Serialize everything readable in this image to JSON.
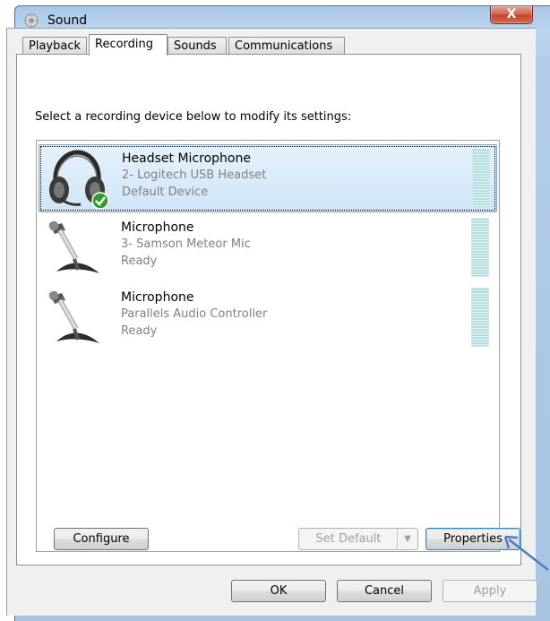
{
  "window": {
    "title": "Sound",
    "close_label": "X"
  },
  "tabs": [
    {
      "label": "Playback"
    },
    {
      "label": "Recording",
      "active": true
    },
    {
      "label": "Sounds"
    },
    {
      "label": "Communications"
    }
  ],
  "instruction": "Select a recording device below to modify its settings:",
  "devices": [
    {
      "name": "Headset Microphone",
      "detail": "2- Logitech USB Headset",
      "status": "Default Device",
      "icon": "headset-icon",
      "selected": true,
      "is_default": true
    },
    {
      "name": "Microphone",
      "detail": "3- Samson Meteor Mic",
      "status": "Ready",
      "icon": "microphone-icon",
      "selected": false
    },
    {
      "name": "Microphone",
      "detail": "Parallels Audio Controller",
      "status": "Ready",
      "icon": "microphone-icon",
      "selected": false
    }
  ],
  "buttons": {
    "configure": "Configure",
    "set_default": "Set Default",
    "properties": "Properties",
    "ok": "OK",
    "cancel": "Cancel",
    "apply": "Apply"
  },
  "colors": {
    "selection": "#cfe5f8",
    "close_button": "#c2422b",
    "secondary_text": "#808080",
    "cursor_arrow": "#4a7fc1"
  }
}
